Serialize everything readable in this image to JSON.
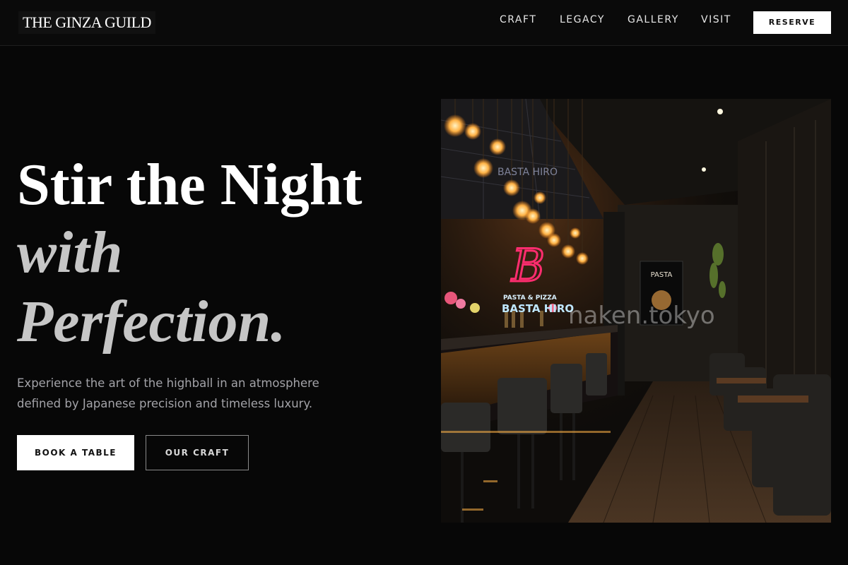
{
  "header": {
    "logo": "THE GINZA GUILD",
    "nav": [
      "CRAFT",
      "LEGACY",
      "GALLERY",
      "VISIT"
    ],
    "reserve_label": "RESERVE"
  },
  "hero": {
    "line1": "Stir the Night",
    "line2": "with",
    "line3": "Perfection.",
    "subtext": "Experience the art of the highball in an atmosphere defined by Japanese precision and timeless luxury.",
    "primary_button": "BOOK A TABLE",
    "secondary_button": "OUR CRAFT"
  },
  "photo": {
    "neon_letter": "B",
    "neon_sign_line1": "PASTA & PIZZA",
    "neon_sign_line2": "BASTA HIRO",
    "poster_title": "PASTA",
    "watermark": "naken.tokyo",
    "mirror_text": "BASTA HIRO"
  },
  "colors": {
    "background": "#070707",
    "header": "#0a0a0a",
    "primary_text": "#ffffff",
    "muted_text": "#a3a3a8",
    "neon_pink": "#ff2d6f",
    "neon_blue": "#9fdcff",
    "warm_light": "#ffb347"
  }
}
